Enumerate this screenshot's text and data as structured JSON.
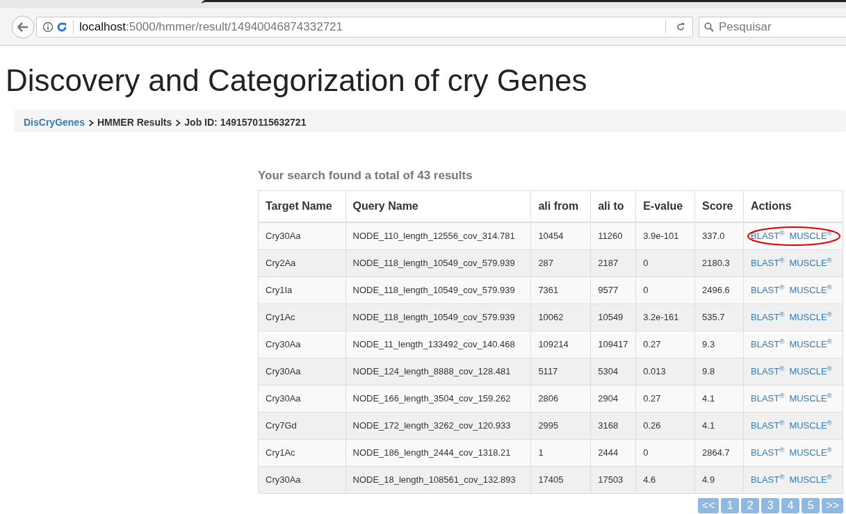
{
  "browser": {
    "url_host": "localhost",
    "url_path": ":5000/hmmer/result/14940046874332721",
    "search_placeholder": "Pesquisar"
  },
  "title": "Discovery and Categorization of cry Genes",
  "breadcrumb": [
    {
      "label": "DisCryGenes",
      "kind": "link"
    },
    {
      "label": "HMMER Results",
      "kind": "text"
    },
    {
      "label": "Job ID: 1491570115632721",
      "kind": "text"
    }
  ],
  "summary": "Your search found a total of 43 results",
  "table": {
    "columns": [
      "Target Name",
      "Query Name",
      "ali from",
      "ali to",
      "E-value",
      "Score",
      "Actions"
    ],
    "rows": [
      {
        "cells": [
          "Cry30Aa",
          "NODE_110_length_12556_cov_314.781",
          "10454",
          "11260",
          "3.9e-101",
          "337.0"
        ],
        "actions": [
          "BLAST$^{®}$",
          "MUSCLE$^{®}$"
        ],
        "circled": true
      },
      {
        "cells": [
          "Cry2Aa",
          "NODE_118_length_10549_cov_579.939",
          "287",
          "2187",
          "0",
          "2180.3"
        ],
        "actions": [
          "BLAST$^{®}$",
          "MUSCLE$^{®}$"
        ],
        "circled": false
      },
      {
        "cells": [
          "Cry1Ia",
          "NODE_118_length_10549_cov_579.939",
          "7361",
          "9577",
          "0",
          "2496.6"
        ],
        "actions": [
          "BLAST$^{®}$",
          "MUSCLE$^{®}$"
        ],
        "circled": false
      },
      {
        "cells": [
          "Cry1Ac",
          "NODE_118_length_10549_cov_579.939",
          "10062",
          "10549",
          "3.2e-161",
          "535.7"
        ],
        "actions": [
          "BLAST$^{®}$",
          "MUSCLE$^{®}$"
        ],
        "circled": false
      },
      {
        "cells": [
          "Cry30Aa",
          "NODE_11_length_133492_cov_140.468",
          "109214",
          "109417",
          "0.27",
          "9.3"
        ],
        "actions": [
          "BLAST$^{®}$",
          "MUSCLE$^{®}$"
        ],
        "circled": false
      },
      {
        "cells": [
          "Cry30Aa",
          "NODE_124_length_8888_cov_128.481",
          "5117",
          "5304",
          "0.013",
          "9.8"
        ],
        "actions": [
          "BLAST$^{®}$",
          "MUSCLE$^{®}$"
        ],
        "circled": false
      },
      {
        "cells": [
          "Cry30Aa",
          "NODE_166_length_3504_cov_159.262",
          "2806",
          "2904",
          "0.27",
          "4.1"
        ],
        "actions": [
          "BLAST$^{®}$",
          "MUSCLE$^{®}$"
        ],
        "circled": false
      },
      {
        "cells": [
          "Cry7Gd",
          "NODE_172_length_3262_cov_120.933",
          "2995",
          "3168",
          "0.26",
          "4.1"
        ],
        "actions": [
          "BLAST$^{®}$",
          "MUSCLE$^{®}$"
        ],
        "circled": false
      },
      {
        "cells": [
          "Cry1Ac",
          "NODE_186_length_2444_cov_1318.21",
          "1",
          "2444",
          "0",
          "2864.7"
        ],
        "actions": [
          "BLAST$^{®}$",
          "MUSCLE$^{®}$"
        ],
        "circled": false
      },
      {
        "cells": [
          "Cry30Aa",
          "NODE_18_length_108561_cov_132.893",
          "17405",
          "17503",
          "4.6",
          "4.9"
        ],
        "actions": [
          "BLAST$^{®}$",
          "MUSCLE$^{®}$"
        ],
        "circled": false
      }
    ]
  },
  "pagination": [
    "<<",
    "1",
    "2",
    "3",
    "4",
    "5",
    ">>"
  ]
}
